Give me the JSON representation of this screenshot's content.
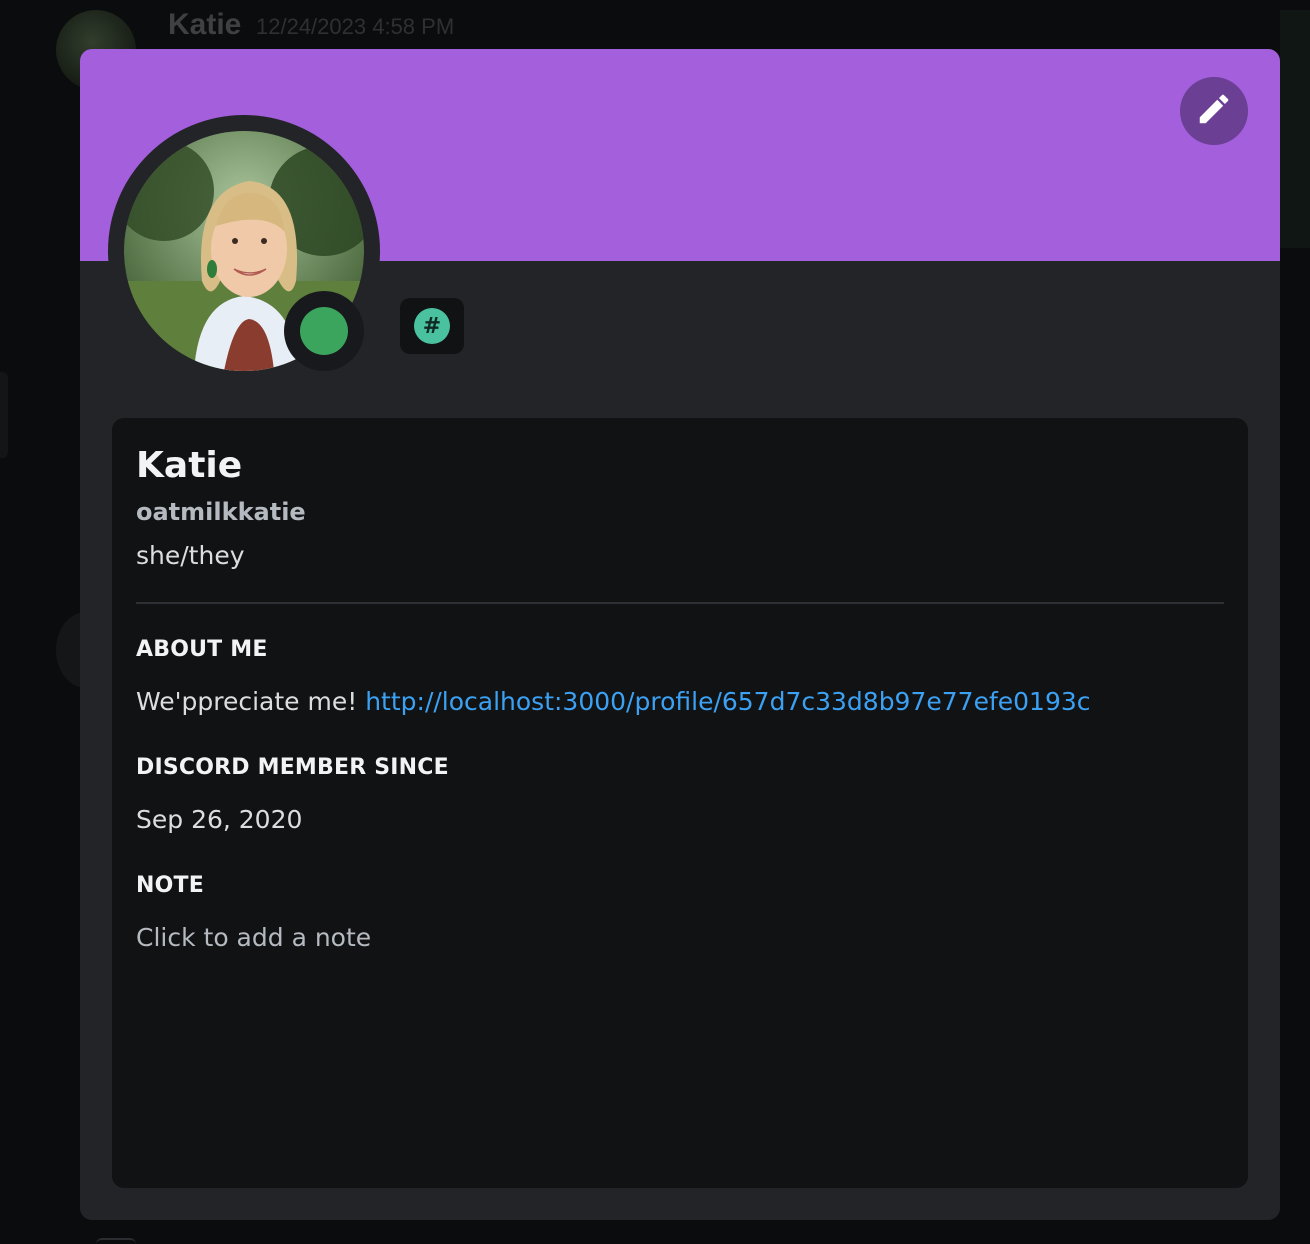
{
  "background": {
    "author_name": "Katie",
    "timestamp": "12/24/2023 4:58 PM"
  },
  "profile": {
    "banner_color": "#a35fdc",
    "edit_icon": "pencil-icon",
    "status": "online",
    "status_color": "#3ba55d",
    "badge_icon": "hashtag-icon",
    "badge_symbol": "#",
    "display_name": "Katie",
    "username": "oatmilkkatie",
    "pronouns": "she/they"
  },
  "sections": {
    "about_title": "ABOUT ME",
    "about_text": "We'ppreciate me! ",
    "about_link": "http://localhost:3000/profile/657d7c33d8b97e77efe0193c",
    "member_since_title": "DISCORD MEMBER SINCE",
    "member_since_date": "Sep 26, 2020",
    "note_title": "NOTE",
    "note_placeholder": "Click to add a note"
  }
}
